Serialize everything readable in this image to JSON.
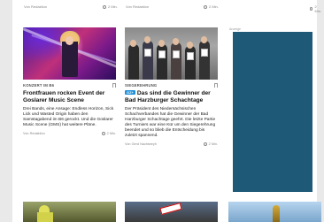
{
  "previous_row": {
    "left_source": "Von Redaktion",
    "left_time": "2 Min.",
    "middle_source": "Von Redaktion",
    "middle_time": "2 Min.",
    "right_time": "2 Min."
  },
  "cards": [
    {
      "kicker": "KONZERT IM B6",
      "badge": "",
      "title": "Frontfrauen rocken Event der Goslarer Music Scene",
      "teaser": "Drei Bands, eine Ansage: Endless Horizon, Sick Lick und Wasted Origin haben den Samstagabend im B6 gerockt. Und die Goslarer Music Scene (GMS) hat weitere Pläne.",
      "source": "Von Redaktion",
      "time": "2 Min."
    },
    {
      "kicker": "SIEGEREHRUNG",
      "badge": "GZ+",
      "title": "Das sind die Gewinner der Bad Harzburger Schachtage",
      "teaser": "Der Präsident des Niedersächsischen Schachverbandes hat die Gewinner der Bad Harzburger Schachtage geehrt. Die letzte Partie des Turniers war eine Kür um den Siegerehrung beendet und so blieb die Entscheidung bis zuletzt spannend.",
      "source": "Von Gerd Nachtweyh",
      "time": "2 Min."
    }
  ],
  "ad": {
    "label": "Anzeige",
    "color": "#1e5a78"
  },
  "colors": {
    "badge": "#1e8fd8",
    "background": "#e9e9e9"
  }
}
